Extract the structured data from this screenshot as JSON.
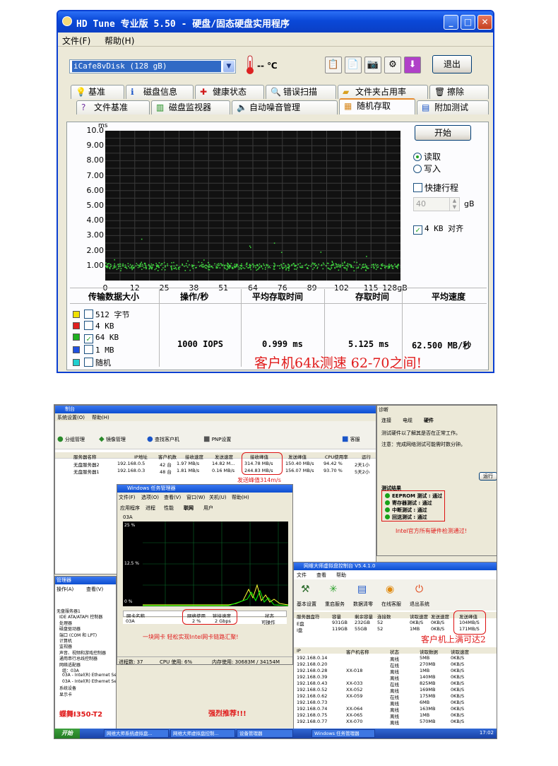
{
  "hdtune": {
    "title": "HD Tune 专业版 5.50 - 硬盘/固态硬盘实用程序",
    "menu": [
      "文件(F)",
      "帮助(H)"
    ],
    "drive": "iCafe8vDisk (128 gB)",
    "temperature": "-- ℃",
    "exit_label": "退出",
    "tabs_row1": [
      {
        "label": "基准",
        "icon": "bulb-icon"
      },
      {
        "label": "磁盘信息",
        "icon": "info-icon"
      },
      {
        "label": "健康状态",
        "icon": "health-cross-icon"
      },
      {
        "label": "错误扫描",
        "icon": "magnifier-icon"
      },
      {
        "label": "文件夹占用率",
        "icon": "folder-icon"
      },
      {
        "label": "擦除",
        "icon": "trash-icon"
      }
    ],
    "tabs_row2": [
      {
        "label": "文件基准",
        "icon": "file-bench-icon"
      },
      {
        "label": "磁盘监视器",
        "icon": "monitor-icon"
      },
      {
        "label": "自动噪音管理",
        "icon": "speaker-icon"
      },
      {
        "label": "随机存取",
        "icon": "random-access-icon"
      },
      {
        "label": "附加测试",
        "icon": "extra-tests-icon"
      }
    ],
    "active_tab": "随机存取",
    "start_label": "开始",
    "read_label": "读取",
    "write_label": "写入",
    "short_stroke_label": "快捷行程",
    "short_stroke_value": "40",
    "short_stroke_unit": "gB",
    "align_label": "4 KB 对齐",
    "table_headers": [
      "传输数据大小",
      "操作/秒",
      "平均存取时间",
      "存取时间",
      "平均速度"
    ],
    "legend": [
      {
        "label": "512 字节",
        "color": "#f0e000",
        "checked": false
      },
      {
        "label": "4 KB",
        "color": "#e02020",
        "checked": false
      },
      {
        "label": "64 KB",
        "color": "#20b020",
        "checked": true
      },
      {
        "label": "1 MB",
        "color": "#2050e0",
        "checked": false
      },
      {
        "label": "随机",
        "color": "#20d0d0",
        "checked": false
      }
    ],
    "results": {
      "ops": "1000 IOPS",
      "avg_access": "0.999 ms",
      "access": "5.125 ms",
      "avg_speed": "62.500 MB/秒"
    },
    "annotation": "客户机64k测速  62-70之间!"
  },
  "chart_data": {
    "type": "scatter",
    "ylabel": "ms",
    "ylim": [
      0,
      10
    ],
    "yticks": [
      "10.0",
      "9.00",
      "8.00",
      "7.00",
      "6.00",
      "5.00",
      "4.00",
      "3.00",
      "2.00",
      "1.00"
    ],
    "xlim": [
      0,
      128
    ],
    "xticks": [
      "0",
      "12",
      "25",
      "38",
      "51",
      "64",
      "76",
      "89",
      "102",
      "115",
      "128gB"
    ],
    "series": [
      {
        "name": "64 KB",
        "color": "#3ed43e",
        "y_center": 1.0,
        "y_spread": 0.25,
        "outliers_max": 3.3
      }
    ]
  },
  "lower": {
    "console_title": "制台",
    "console_menu": [
      "系统设置(O)",
      "帮助(H)"
    ],
    "console_toolbar": [
      "分组管理",
      "镜像管理",
      "查找客户机",
      "PNP设置",
      "客服"
    ],
    "server_cols": [
      "服务器名称",
      "IP地址",
      "客户机数",
      "接收速度",
      "发送速度",
      "接收峰值",
      "发送峰值",
      "CPU使用率",
      "运行"
    ],
    "servers": [
      [
        "无盘服务器2",
        "192.168.0.5",
        "42 台",
        "1.97 MB/s",
        "14.82 M...",
        "314.78 MB/s",
        "150.40 MB/s",
        "94.42 %",
        "2天1小"
      ],
      [
        "无盘服务器1",
        "192.168.0.3",
        "48 台",
        "1.81 MB/s",
        "0.16 MB/s",
        "244.83 MB/s",
        "156.07 MB/s",
        "93.70 %",
        "5天2小"
      ]
    ],
    "peak_note": "发送峰值314m/s",
    "diag_title": "诊断",
    "diag_tabs": [
      "连接",
      "电缆",
      "硬件"
    ],
    "diag_text1": "测试硬件以了解其是否在正常工作。",
    "diag_text2": "注意：完成网络测试可能需时数分钟。",
    "diag_run": "运行",
    "diag_results_title": "测试结果",
    "diag_results": [
      [
        "EEPROM 测试",
        "通过"
      ],
      [
        "寄存器测试",
        "通过"
      ],
      [
        "中断测试",
        "通过"
      ],
      [
        "回送测试",
        "通过"
      ]
    ],
    "intel_note": "Intel官方所有硬件检测通过!",
    "taskmgr_title": "Windows 任务管理器",
    "taskmgr_menu": [
      "文件(F)",
      "选项(O)",
      "查看(V)",
      "窗口(W)",
      "关机(U)",
      "帮助(H)"
    ],
    "taskmgr_tabs": [
      "应用程序",
      "进程",
      "性能",
      "联网",
      "用户"
    ],
    "taskmgr_adapter": "03A",
    "taskmgr_scale": [
      "25 %",
      "12.5 %",
      "0 %"
    ],
    "taskmgr_cols": [
      "网卡名称",
      "网络使用",
      "链接速度",
      "状态"
    ],
    "taskmgr_row": [
      "03A",
      "2 %",
      "2 Gbps",
      "可操作"
    ],
    "taskmgr_note": "一块网卡  轻松实现Intel网卡链路汇聚!",
    "taskmgr_status": [
      "进程数: 37",
      "CPU 使用: 6%",
      "内存使用: 30683M / 34154M"
    ],
    "devmgr_title": "管理器",
    "devmgr_menu": [
      "操作(A)",
      "查看(V)"
    ],
    "devmgr_items": [
      "无盘服务器1",
      "IDE ATA/ATAPI 控制器",
      "处理器",
      "磁盘驱动器",
      "端口 (COM 和 LPT)",
      "计算机",
      "监视器",
      "声音、视频和游戏控制器",
      "通用串行总线控制器",
      "网络适配器",
      "组：03A",
      "03A - Intel(R) Ethernet Server Adapter I350-T2",
      "03A - Intel(R) Ethernet Server Adapter I350-T2 #2",
      "系统设备",
      "显示卡"
    ],
    "butterfly_note": "蝶舞I350-T2",
    "recommend_note": "强烈推荐!!!",
    "wm_title": "网维大师虚拟盘控制台 V5.4.1.0",
    "wm_menu": [
      "文件",
      "查看",
      "帮助"
    ],
    "wm_toolbar": [
      "基本设置",
      "重启服务",
      "数据清零",
      "在线客服",
      "退出系统"
    ],
    "wm_disk_cols": [
      "服务器盘符",
      "容量",
      "剩余容量",
      "连接数",
      "读取速度",
      "发送速度",
      "发送峰值"
    ],
    "wm_disks": [
      [
        "E盘",
        "931GB",
        "232GB",
        "52",
        "0KB/S",
        "0KB/S",
        "104MB/S"
      ],
      [
        "I盘",
        "119GB",
        "55GB",
        "52",
        "1MB",
        "0KB/S",
        "171MB/S"
      ]
    ],
    "wm_note": "客户机上满可达2",
    "wm_client_cols": [
      "IP",
      "客户机名称",
      "状态",
      "读取数据",
      "读取速度"
    ],
    "wm_clients": [
      [
        "192.168.0.14",
        "",
        "离线",
        "5MB",
        "0KB/S"
      ],
      [
        "192.168.0.20",
        "",
        "在线",
        "270MB",
        "0KB/S"
      ],
      [
        "192.168.0.28",
        "XX-018",
        "离线",
        "1MB",
        "0KB/S"
      ],
      [
        "192.168.0.39",
        "",
        "离线",
        "140MB",
        "0KB/S"
      ],
      [
        "192.168.0.43",
        "XX-033",
        "在线",
        "825MB",
        "0KB/S"
      ],
      [
        "192.168.0.52",
        "XX-052",
        "离线",
        "169MB",
        "0KB/S"
      ],
      [
        "192.168.0.62",
        "XX-059",
        "在线",
        "175MB",
        "0KB/S"
      ],
      [
        "192.168.0.73",
        "",
        "离线",
        "6MB",
        "0KB/S"
      ],
      [
        "192.168.0.74",
        "XX-064",
        "离线",
        "163MB",
        "0KB/S"
      ],
      [
        "192.168.0.75",
        "XX-065",
        "离线",
        "1MB",
        "0KB/S"
      ],
      [
        "192.168.0.77",
        "XX-070",
        "离线",
        "570MB",
        "0KB/S"
      ]
    ],
    "taskbar": {
      "start": "开始",
      "tasks": [
        "网维大师系统虚拟盘...",
        "网维大师虚拟盘控制...",
        "设备管理器",
        "Windows 任务管理器"
      ],
      "clock": "17:02"
    }
  }
}
